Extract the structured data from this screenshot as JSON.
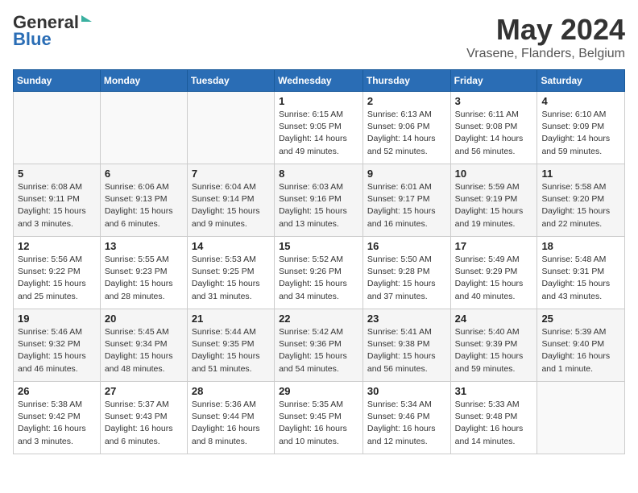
{
  "logo": {
    "line1": "General",
    "line2": "Blue"
  },
  "title": "May 2024",
  "subtitle": "Vrasene, Flanders, Belgium",
  "headers": [
    "Sunday",
    "Monday",
    "Tuesday",
    "Wednesday",
    "Thursday",
    "Friday",
    "Saturday"
  ],
  "weeks": [
    [
      {
        "day": "",
        "info": ""
      },
      {
        "day": "",
        "info": ""
      },
      {
        "day": "",
        "info": ""
      },
      {
        "day": "1",
        "info": "Sunrise: 6:15 AM\nSunset: 9:05 PM\nDaylight: 14 hours\nand 49 minutes."
      },
      {
        "day": "2",
        "info": "Sunrise: 6:13 AM\nSunset: 9:06 PM\nDaylight: 14 hours\nand 52 minutes."
      },
      {
        "day": "3",
        "info": "Sunrise: 6:11 AM\nSunset: 9:08 PM\nDaylight: 14 hours\nand 56 minutes."
      },
      {
        "day": "4",
        "info": "Sunrise: 6:10 AM\nSunset: 9:09 PM\nDaylight: 14 hours\nand 59 minutes."
      }
    ],
    [
      {
        "day": "5",
        "info": "Sunrise: 6:08 AM\nSunset: 9:11 PM\nDaylight: 15 hours\nand 3 minutes."
      },
      {
        "day": "6",
        "info": "Sunrise: 6:06 AM\nSunset: 9:13 PM\nDaylight: 15 hours\nand 6 minutes."
      },
      {
        "day": "7",
        "info": "Sunrise: 6:04 AM\nSunset: 9:14 PM\nDaylight: 15 hours\nand 9 minutes."
      },
      {
        "day": "8",
        "info": "Sunrise: 6:03 AM\nSunset: 9:16 PM\nDaylight: 15 hours\nand 13 minutes."
      },
      {
        "day": "9",
        "info": "Sunrise: 6:01 AM\nSunset: 9:17 PM\nDaylight: 15 hours\nand 16 minutes."
      },
      {
        "day": "10",
        "info": "Sunrise: 5:59 AM\nSunset: 9:19 PM\nDaylight: 15 hours\nand 19 minutes."
      },
      {
        "day": "11",
        "info": "Sunrise: 5:58 AM\nSunset: 9:20 PM\nDaylight: 15 hours\nand 22 minutes."
      }
    ],
    [
      {
        "day": "12",
        "info": "Sunrise: 5:56 AM\nSunset: 9:22 PM\nDaylight: 15 hours\nand 25 minutes."
      },
      {
        "day": "13",
        "info": "Sunrise: 5:55 AM\nSunset: 9:23 PM\nDaylight: 15 hours\nand 28 minutes."
      },
      {
        "day": "14",
        "info": "Sunrise: 5:53 AM\nSunset: 9:25 PM\nDaylight: 15 hours\nand 31 minutes."
      },
      {
        "day": "15",
        "info": "Sunrise: 5:52 AM\nSunset: 9:26 PM\nDaylight: 15 hours\nand 34 minutes."
      },
      {
        "day": "16",
        "info": "Sunrise: 5:50 AM\nSunset: 9:28 PM\nDaylight: 15 hours\nand 37 minutes."
      },
      {
        "day": "17",
        "info": "Sunrise: 5:49 AM\nSunset: 9:29 PM\nDaylight: 15 hours\nand 40 minutes."
      },
      {
        "day": "18",
        "info": "Sunrise: 5:48 AM\nSunset: 9:31 PM\nDaylight: 15 hours\nand 43 minutes."
      }
    ],
    [
      {
        "day": "19",
        "info": "Sunrise: 5:46 AM\nSunset: 9:32 PM\nDaylight: 15 hours\nand 46 minutes."
      },
      {
        "day": "20",
        "info": "Sunrise: 5:45 AM\nSunset: 9:34 PM\nDaylight: 15 hours\nand 48 minutes."
      },
      {
        "day": "21",
        "info": "Sunrise: 5:44 AM\nSunset: 9:35 PM\nDaylight: 15 hours\nand 51 minutes."
      },
      {
        "day": "22",
        "info": "Sunrise: 5:42 AM\nSunset: 9:36 PM\nDaylight: 15 hours\nand 54 minutes."
      },
      {
        "day": "23",
        "info": "Sunrise: 5:41 AM\nSunset: 9:38 PM\nDaylight: 15 hours\nand 56 minutes."
      },
      {
        "day": "24",
        "info": "Sunrise: 5:40 AM\nSunset: 9:39 PM\nDaylight: 15 hours\nand 59 minutes."
      },
      {
        "day": "25",
        "info": "Sunrise: 5:39 AM\nSunset: 9:40 PM\nDaylight: 16 hours\nand 1 minute."
      }
    ],
    [
      {
        "day": "26",
        "info": "Sunrise: 5:38 AM\nSunset: 9:42 PM\nDaylight: 16 hours\nand 3 minutes."
      },
      {
        "day": "27",
        "info": "Sunrise: 5:37 AM\nSunset: 9:43 PM\nDaylight: 16 hours\nand 6 minutes."
      },
      {
        "day": "28",
        "info": "Sunrise: 5:36 AM\nSunset: 9:44 PM\nDaylight: 16 hours\nand 8 minutes."
      },
      {
        "day": "29",
        "info": "Sunrise: 5:35 AM\nSunset: 9:45 PM\nDaylight: 16 hours\nand 10 minutes."
      },
      {
        "day": "30",
        "info": "Sunrise: 5:34 AM\nSunset: 9:46 PM\nDaylight: 16 hours\nand 12 minutes."
      },
      {
        "day": "31",
        "info": "Sunrise: 5:33 AM\nSunset: 9:48 PM\nDaylight: 16 hours\nand 14 minutes."
      },
      {
        "day": "",
        "info": ""
      }
    ]
  ]
}
